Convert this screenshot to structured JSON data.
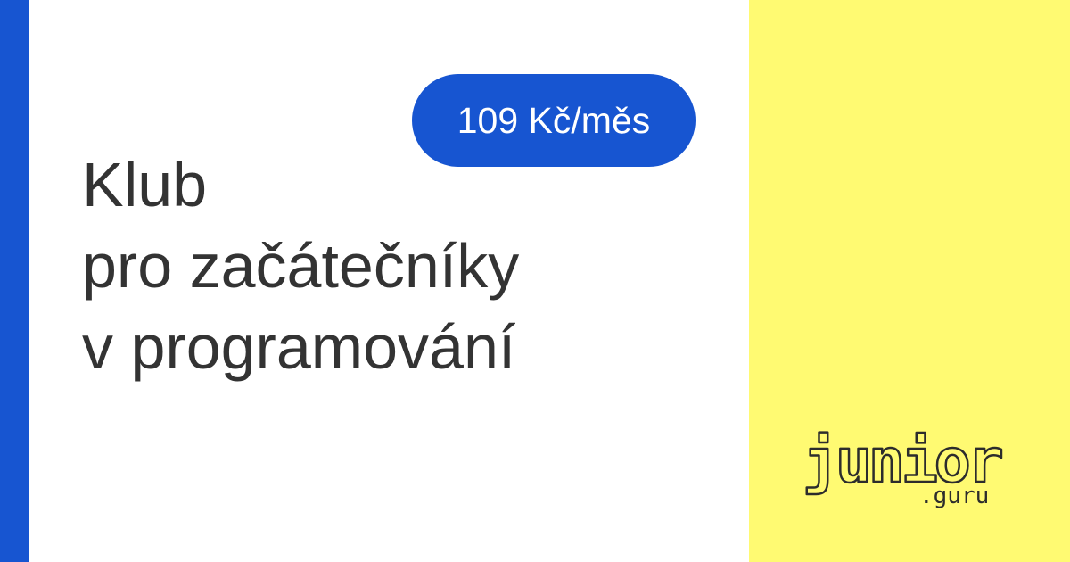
{
  "badge": {
    "price": "109 Kč/měs"
  },
  "headline": {
    "lines": [
      "Klub",
      "pro začátečníky",
      "v programování"
    ]
  },
  "logo": {
    "word": "junior",
    "suffix": ".guru"
  },
  "colors": {
    "accent_blue": "#1755d1",
    "brand_yellow": "#fffa72",
    "text_dark": "#333333",
    "background": "#ffffff"
  }
}
